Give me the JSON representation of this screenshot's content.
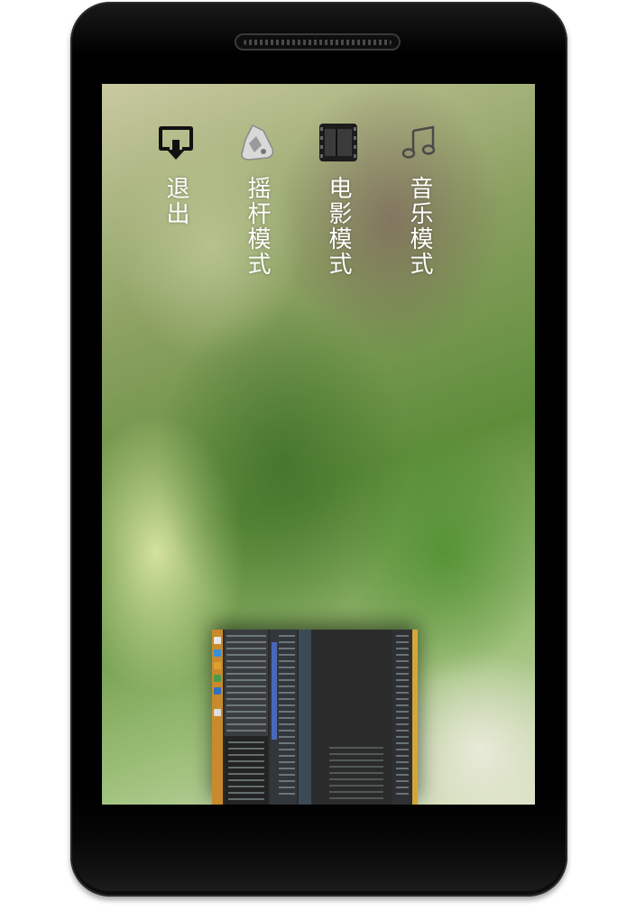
{
  "menu": {
    "items": [
      {
        "id": "exit",
        "label": "退出",
        "icon": "exit-icon"
      },
      {
        "id": "joystick",
        "label": "摇杆模式",
        "icon": "joystick-icon"
      },
      {
        "id": "movie",
        "label": "电影模式",
        "icon": "film-icon"
      },
      {
        "id": "music",
        "label": "音乐模式",
        "icon": "music-note-icon"
      }
    ]
  },
  "recent_app": {
    "description_icon": "recent-app-thumbnail"
  }
}
